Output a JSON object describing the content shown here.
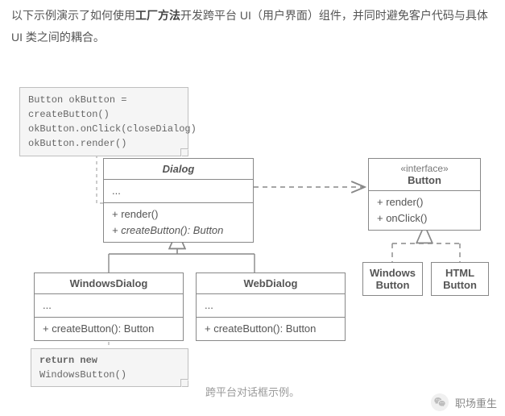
{
  "intro": {
    "before_bold": "以下示例演示了如何使用",
    "bold": "工厂方法",
    "after_bold": "开发跨平台 UI（用户界面）组件，并同时避免客户代码与具体 UI 类之间的耦合。"
  },
  "note_top": {
    "line1": "Button okButton = createButton()",
    "line2": "okButton.onClick(closeDialog)",
    "line3": "okButton.render()"
  },
  "dialog": {
    "title": "Dialog",
    "attrs": "...",
    "op1": "+ render()",
    "op2": "+ createButton(): Button"
  },
  "button_iface": {
    "stereotype": "«interface»",
    "title": "Button",
    "op1": "+ render()",
    "op2": "+ onClick()"
  },
  "windows_dialog": {
    "title": "WindowsDialog",
    "attrs": "...",
    "op1": "+ createButton(): Button"
  },
  "web_dialog": {
    "title": "WebDialog",
    "attrs": "...",
    "op1": "+ createButton(): Button"
  },
  "windows_button": {
    "title_l1": "Windows",
    "title_l2": "Button"
  },
  "html_button": {
    "title_l1": "HTML",
    "title_l2": "Button"
  },
  "note_bottom": {
    "prefix": "return new ",
    "klass": "WindowsButton()"
  },
  "caption": "跨平台对话框示例。",
  "footer_brand": "职场重生"
}
